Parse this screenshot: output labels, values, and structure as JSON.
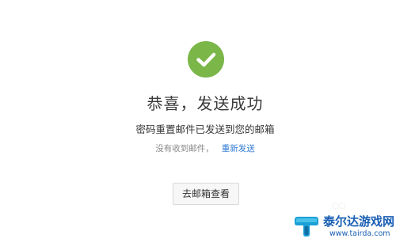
{
  "success": {
    "icon": "checkmark-circle-icon",
    "icon_color": "#7ab648",
    "title": "恭喜，发送成功",
    "message": "密码重置邮件已发送到您的邮箱"
  },
  "hint": {
    "text": "没有收到邮件，",
    "resend_link": "重新发送",
    "link_color": "#2e7ad3"
  },
  "actions": {
    "goto_mailbox_label": "去邮箱查看"
  },
  "watermark": {
    "brand": "泰尔达游戏网",
    "url": "www.tairda.com",
    "color": "#1a5fb4"
  },
  "faint_mark": "◌◌"
}
